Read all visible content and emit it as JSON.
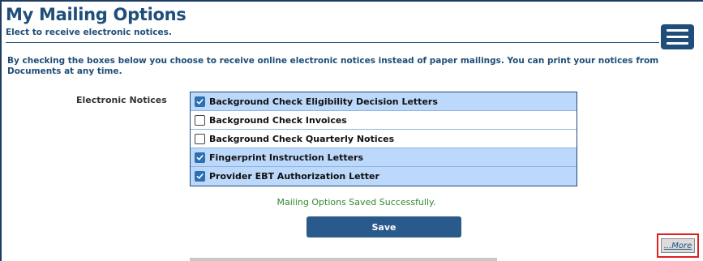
{
  "header": {
    "title": "My Mailing Options",
    "subtitle": "Elect to receive electronic notices."
  },
  "menu_icon": "hamburger-menu-icon",
  "intro": "By checking the boxes below you choose to receive online electronic notices instead of paper mailings. You can print your notices from Documents at any time.",
  "notices": {
    "label": "Electronic Notices",
    "items": [
      {
        "label": "Background Check Eligibility Decision Letters",
        "checked": true
      },
      {
        "label": "Background Check Invoices",
        "checked": false
      },
      {
        "label": "Background Check Quarterly Notices",
        "checked": false
      },
      {
        "label": "Fingerprint Instruction Letters",
        "checked": true
      },
      {
        "label": "Provider EBT Authorization Letter",
        "checked": true
      }
    ]
  },
  "status_message": "Mailing Options Saved Successfully.",
  "save_label": "Save",
  "more_label": "...More",
  "colors": {
    "primary": "#1e4e79",
    "checked_row": "#bcd8fb",
    "success": "#2f8a2f",
    "highlight": "#e02020"
  }
}
